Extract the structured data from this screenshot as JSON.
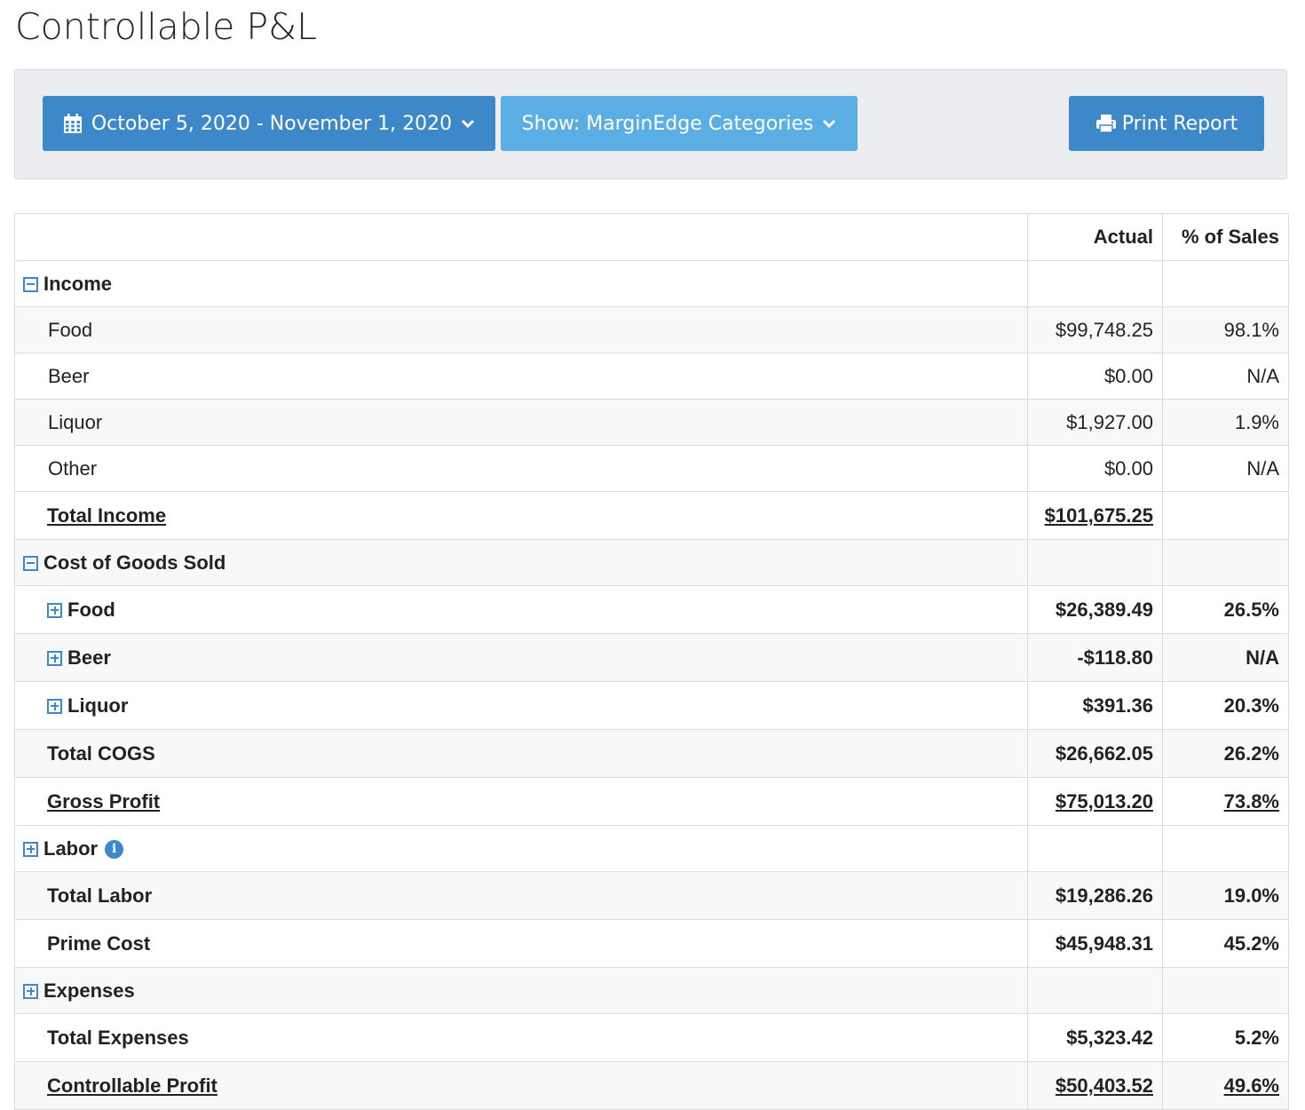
{
  "page": {
    "title": "Controllable P&L"
  },
  "toolbar": {
    "date_range_label": "October 5, 2020 - November 1, 2020",
    "show_label": "Show: MarginEdge Categories",
    "print_label": "Print Report"
  },
  "table": {
    "headers": {
      "label": "",
      "actual": "Actual",
      "pct": "% of Sales"
    },
    "income": {
      "label": "Income",
      "rows": [
        {
          "label": "Food",
          "actual": "$99,748.25",
          "pct": "98.1%"
        },
        {
          "label": "Beer",
          "actual": "$0.00",
          "pct": "N/A"
        },
        {
          "label": "Liquor",
          "actual": "$1,927.00",
          "pct": "1.9%"
        },
        {
          "label": "Other",
          "actual": "$0.00",
          "pct": "N/A"
        }
      ],
      "total": {
        "label": "Total Income",
        "actual": "$101,675.25",
        "pct": ""
      }
    },
    "cogs": {
      "label": "Cost of Goods Sold",
      "rows": [
        {
          "label": "Food",
          "actual": "$26,389.49",
          "pct": "26.5%"
        },
        {
          "label": "Beer",
          "actual": "-$118.80",
          "pct": "N/A"
        },
        {
          "label": "Liquor",
          "actual": "$391.36",
          "pct": "20.3%"
        }
      ],
      "total": {
        "label": "Total COGS",
        "actual": "$26,662.05",
        "pct": "26.2%"
      }
    },
    "gross_profit": {
      "label": "Gross Profit",
      "actual": "$75,013.20",
      "pct": "73.8%"
    },
    "labor": {
      "label": "Labor",
      "total": {
        "label": "Total Labor",
        "actual": "$19,286.26",
        "pct": "19.0%"
      }
    },
    "prime_cost": {
      "label": "Prime Cost",
      "actual": "$45,948.31",
      "pct": "45.2%"
    },
    "expenses": {
      "label": "Expenses",
      "total": {
        "label": "Total Expenses",
        "actual": "$5,323.42",
        "pct": "5.2%"
      }
    },
    "controllable_profit": {
      "label": "Controllable Profit",
      "actual": "$50,403.52",
      "pct": "49.6%"
    }
  },
  "icons": {
    "date_button": "calendar-icon",
    "dropdown": "chevron-down-icon",
    "print_button": "printer-icon",
    "expanded_section": "minus-square-icon",
    "collapsed_section": "plus-square-icon",
    "labor_info": "info-icon"
  },
  "colors": {
    "primary": "#3d88c8",
    "secondary": "#5aaee3",
    "toolbar_bg": "#ebedf0"
  }
}
